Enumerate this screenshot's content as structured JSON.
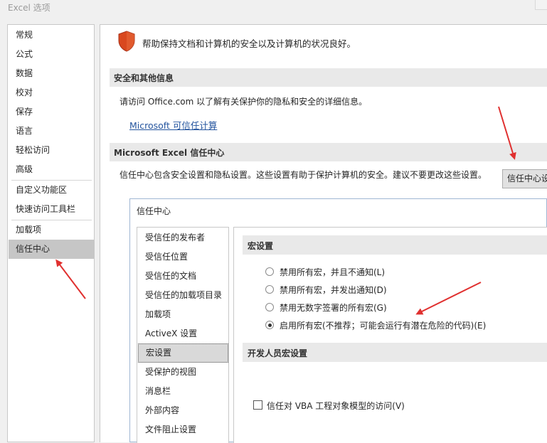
{
  "window": {
    "title": "Excel 选项"
  },
  "nav": {
    "items": [
      {
        "label": "常规"
      },
      {
        "label": "公式"
      },
      {
        "label": "数据"
      },
      {
        "label": "校对"
      },
      {
        "label": "保存"
      },
      {
        "label": "语言"
      },
      {
        "label": "轻松访问"
      },
      {
        "label": "高级"
      },
      {
        "label": "自定义功能区"
      },
      {
        "label": "快速访问工具栏"
      },
      {
        "label": "加载项"
      },
      {
        "label": "信任中心"
      }
    ],
    "selected": "信任中心"
  },
  "main": {
    "intro": "帮助保持文档和计算机的安全以及计算机的状况良好。",
    "privacy_section_title": "安全和其他信息",
    "privacy_info": "请访问 Office.com 以了解有关保护你的隐私和安全的详细信息。",
    "privacy_link": "Microsoft 可信任计算",
    "trust_section_title": "Microsoft Excel 信任中心",
    "trust_desc": "信任中心包含安全设置和隐私设置。这些设置有助于保护计算机的安全。建议不要更改这些设置。",
    "trust_button": "信任中心设置..."
  },
  "dialog": {
    "title": "信任中心",
    "nav": [
      {
        "label": "受信任的发布者"
      },
      {
        "label": "受信任位置"
      },
      {
        "label": "受信任的文档"
      },
      {
        "label": "受信任的加载项目录"
      },
      {
        "label": "加载项"
      },
      {
        "label": "ActiveX 设置"
      },
      {
        "label": "宏设置"
      },
      {
        "label": "受保护的视图"
      },
      {
        "label": "消息栏"
      },
      {
        "label": "外部内容"
      },
      {
        "label": "文件阻止设置"
      }
    ],
    "nav_selected": "宏设置",
    "macro_section_title": "宏设置",
    "macro_options": [
      {
        "label": "禁用所有宏，并且不通知(L)",
        "checked": false
      },
      {
        "label": "禁用所有宏，并发出通知(D)",
        "checked": false
      },
      {
        "label": "禁用无数字签署的所有宏(G)",
        "checked": false
      },
      {
        "label": "启用所有宏(不推荐；可能会运行有潜在危险的代码)(E)",
        "checked": true
      }
    ],
    "dev_section_title": "开发人员宏设置",
    "vba_label": "信任对 VBA 工程对象模型的访问(V)",
    "vba_checked": false
  },
  "colors": {
    "accent_link": "#24549e",
    "shield": "#d9481f",
    "arrow": "#e0302f",
    "selected_nav": "#c6c6c6"
  }
}
